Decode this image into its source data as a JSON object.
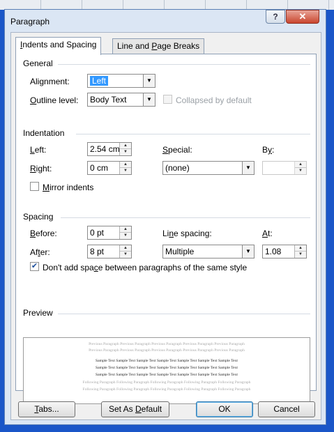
{
  "window": {
    "title": "Paragraph",
    "help_label": "?",
    "close_label": "✕"
  },
  "tabs": [
    {
      "label": "Indents and Spacing",
      "active": true
    },
    {
      "label": "Line and Page Breaks",
      "active": false
    }
  ],
  "general": {
    "heading": "General",
    "alignment_label": "Alignment:",
    "alignment_value": "Left",
    "outline_label": "Outline level:",
    "outline_value": "Body Text",
    "collapsed_label": "Collapsed by default"
  },
  "indentation": {
    "heading": "Indentation",
    "left_label": "Left:",
    "left_value": "2.54 cm",
    "right_label": "Right:",
    "right_value": "0 cm",
    "special_label": "Special:",
    "special_value": "(none)",
    "by_label": "By:",
    "by_value": "",
    "mirror_label": "Mirror indents"
  },
  "spacing": {
    "heading": "Spacing",
    "before_label": "Before:",
    "before_value": "0 pt",
    "after_label": "After:",
    "after_value": "8 pt",
    "line_spacing_label": "Line spacing:",
    "line_spacing_value": "Multiple",
    "at_label": "At:",
    "at_value": "1.08",
    "dont_add_label": "Don't add space between paragraphs of the same style",
    "dont_add_checked": true
  },
  "preview": {
    "heading": "Preview",
    "prev_line_1": "Previous Paragraph Previous Paragraph Previous Paragraph Previous Paragraph Previous Paragraph",
    "prev_line_2": "Previous Paragraph Previous Paragraph Previous Paragraph Previous Paragraph Previous Paragraph",
    "sample_line_1": "Sample Text Sample Text Sample Text Sample Text Sample Text Sample Text Sample Text",
    "sample_line_2": "Sample Text Sample Text Sample Text Sample Text Sample Text Sample Text Sample Text",
    "sample_line_3": "Sample Text Sample Text Sample Text Sample Text Sample Text Sample Text Sample Text",
    "follow_line_1": "Following Paragraph Following Paragraph Following Paragraph Following Paragraph Following Paragraph",
    "follow_line_2": "Following Paragraph Following Paragraph Following Paragraph Following Paragraph Following Paragraph"
  },
  "buttons": {
    "tabs": "Tabs...",
    "set_default": "Set As Default",
    "ok": "OK",
    "cancel": "Cancel"
  },
  "colors": {
    "background": "#1a56c8",
    "dialog_frame": "#dbe6f4",
    "close_button": "#c9462f",
    "selection": "#3399ff"
  }
}
